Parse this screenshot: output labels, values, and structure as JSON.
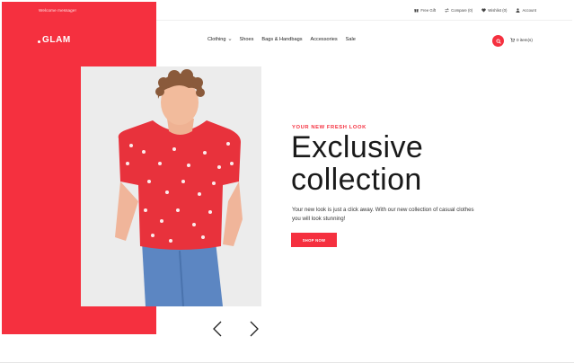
{
  "topbar": {
    "welcome": "Welcome message!",
    "links": [
      {
        "label": "Free Gift",
        "icon": "gift-icon"
      },
      {
        "label": "Compare (0)",
        "icon": "compare-icon"
      },
      {
        "label": "Wishlist (0)",
        "icon": "heart-icon"
      },
      {
        "label": "Account",
        "icon": "user-icon"
      }
    ]
  },
  "brand": {
    "name": "GLAM",
    "color": "#f5303f"
  },
  "nav": {
    "items": [
      {
        "label": "Clothing",
        "has_dropdown": true
      },
      {
        "label": "Shoes"
      },
      {
        "label": "Bags & Handbags"
      },
      {
        "label": "Accessories"
      },
      {
        "label": "Sale"
      }
    ]
  },
  "header": {
    "search_icon": "search-icon",
    "cart_label": "0 item(s)"
  },
  "hero": {
    "eyebrow": "YOUR NEW FRESH LOOK",
    "title_line1": "Exclusive",
    "title_line2": "collection",
    "description": "Your new look is just a click away. With our new collection of casual clothes you will look stunning!",
    "cta_label": "SHOP NOW",
    "prev_icon": "chevron-left-icon",
    "next_icon": "chevron-right-icon"
  }
}
